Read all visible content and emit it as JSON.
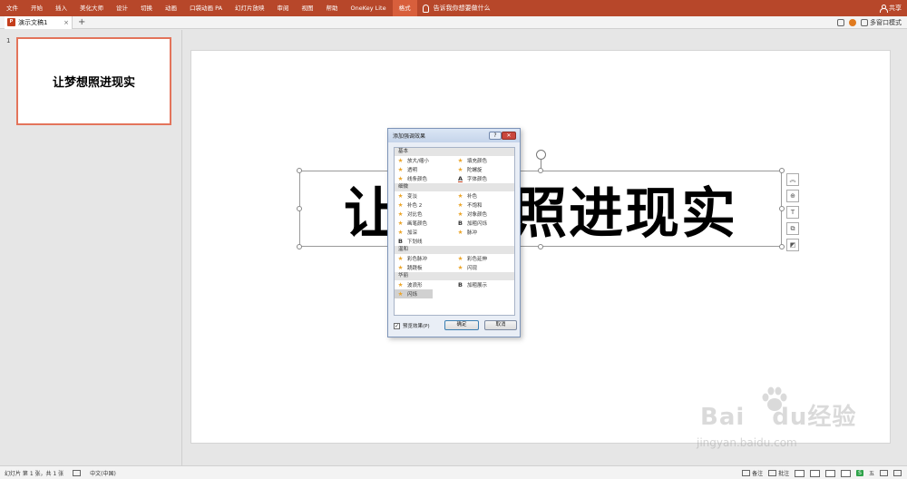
{
  "ribbon": {
    "tabs": [
      "文件",
      "开始",
      "插入",
      "美化大师",
      "设计",
      "切换",
      "动画",
      "口袋动画 PA",
      "幻灯片放映",
      "审阅",
      "视图",
      "帮助",
      "OneKey Lite",
      "格式"
    ],
    "active_tab": "格式",
    "tell_me": "告诉我你想要做什么",
    "share": "共享"
  },
  "docbar": {
    "doc_name": "演示文稿1",
    "close": "×",
    "add": "+",
    "windows_mode": "多窗口模式"
  },
  "thumbnails": {
    "slide_number": "1",
    "slide_text": "让梦想照进现实"
  },
  "slide": {
    "text": "让梦想照进现实",
    "side_tools": [
      "︽",
      "⊕",
      "T",
      "⧉",
      "◩"
    ]
  },
  "dialog": {
    "title": "添加强调效果",
    "help": "?",
    "close": "✕",
    "groups": [
      {
        "name": "基本",
        "rows": [
          [
            {
              "icon": "star",
              "label": "放大/缩小"
            },
            {
              "icon": "star",
              "label": "填充颜色"
            }
          ],
          [
            {
              "icon": "star",
              "label": "透明"
            },
            {
              "icon": "star",
              "label": "陀螺旋"
            }
          ],
          [
            {
              "icon": "star",
              "label": "线条颜色"
            },
            {
              "icon": "font-color",
              "label": "字体颜色"
            }
          ]
        ]
      },
      {
        "name": "细微",
        "rows": [
          [
            {
              "icon": "star",
              "label": "变淡"
            },
            {
              "icon": "star",
              "label": "补色"
            }
          ],
          [
            {
              "icon": "star",
              "label": "补色 2"
            },
            {
              "icon": "star",
              "label": "不饱和"
            }
          ],
          [
            {
              "icon": "star",
              "label": "对比色"
            },
            {
              "icon": "star",
              "label": "对象颜色"
            }
          ],
          [
            {
              "icon": "star",
              "label": "画笔颜色"
            },
            {
              "icon": "bold",
              "label": "加粗闪烁"
            }
          ],
          [
            {
              "icon": "star",
              "label": "加深"
            },
            {
              "icon": "star",
              "label": "脉冲"
            }
          ],
          [
            {
              "icon": "bold",
              "label": "下划线"
            }
          ]
        ]
      },
      {
        "name": "温和",
        "rows": [
          [
            {
              "icon": "star",
              "label": "彩色脉冲"
            },
            {
              "icon": "star",
              "label": "彩色延伸"
            }
          ],
          [
            {
              "icon": "star",
              "label": "跷跷板"
            },
            {
              "icon": "star",
              "label": "闪现"
            }
          ]
        ]
      },
      {
        "name": "华丽",
        "rows": [
          [
            {
              "icon": "star",
              "label": "波浪形"
            },
            {
              "icon": "bold",
              "label": "加粗展示"
            }
          ],
          [
            {
              "icon": "star",
              "label": "闪烁",
              "selected": true
            }
          ]
        ]
      }
    ],
    "preview_label": "预览效果(P)",
    "preview_checked": "✓",
    "ok": "确定",
    "cancel": "取消"
  },
  "status": {
    "slide_info": "幻灯片 第 1 张，共 1 张",
    "language": "中文(中国)",
    "notes": "备注",
    "comments": "批注",
    "ime_label": "五"
  },
  "watermark": {
    "logo_left": "Bai",
    "logo_right": "du",
    "logo_cn": "经验",
    "url": "jingyan.baidu.com"
  }
}
